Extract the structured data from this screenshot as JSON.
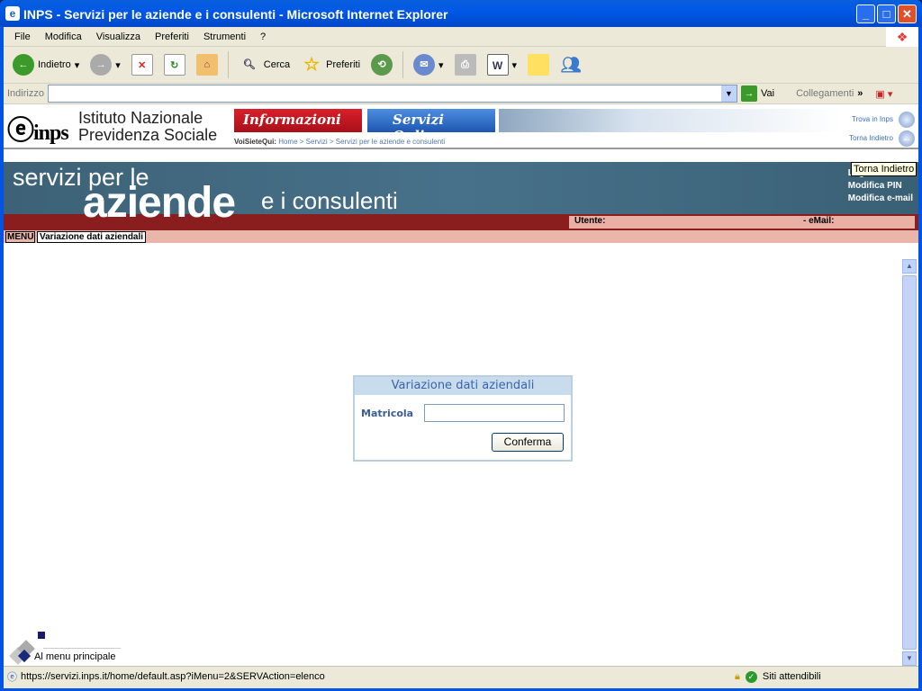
{
  "window": {
    "title": "INPS - Servizi per le aziende e i consulenti - Microsoft Internet Explorer"
  },
  "menubar": [
    "File",
    "Modifica",
    "Visualizza",
    "Preferiti",
    "Strumenti",
    "?"
  ],
  "toolbar": {
    "back": "Indietro",
    "search": "Cerca",
    "favorites": "Preferiti"
  },
  "address": {
    "label": "Indirizzo",
    "value": "",
    "go": "Vai",
    "links": "Collegamenti"
  },
  "header": {
    "logo": "e-inps",
    "institute_line1": "Istituto Nazionale",
    "institute_line2": "Previdenza Sociale",
    "tab_info": "Informazioni",
    "tab_services": "Servizi Online",
    "crumb_prefix": "VoiSieteQui:",
    "crumb": "Home > Servizi > Servizi per le aziende e consulenti",
    "find": "Trova in Inps",
    "back": "Torna Indietro"
  },
  "banner": {
    "line1": "servizi per le",
    "line2": "aziende",
    "line3": "e i consulenti",
    "links": [
      "Logout",
      "Modifica PIN",
      "Modifica e-mail"
    ],
    "user_label": "Utente:",
    "email_label": "- eMail:"
  },
  "nav": {
    "menu": "MENU",
    "current": "Variazione dati aziendali"
  },
  "tooltip": "Torna Indietro",
  "form": {
    "title": "Variazione dati aziendali",
    "field_label": "Matricola",
    "field_value": "",
    "submit": "Conferma"
  },
  "footer": {
    "back_to_menu": "Al menu principale"
  },
  "status": {
    "url": "https://servizi.inps.it/home/default.asp?iMenu=2&SERVAction=elenco",
    "zone": "Siti attendibili"
  }
}
